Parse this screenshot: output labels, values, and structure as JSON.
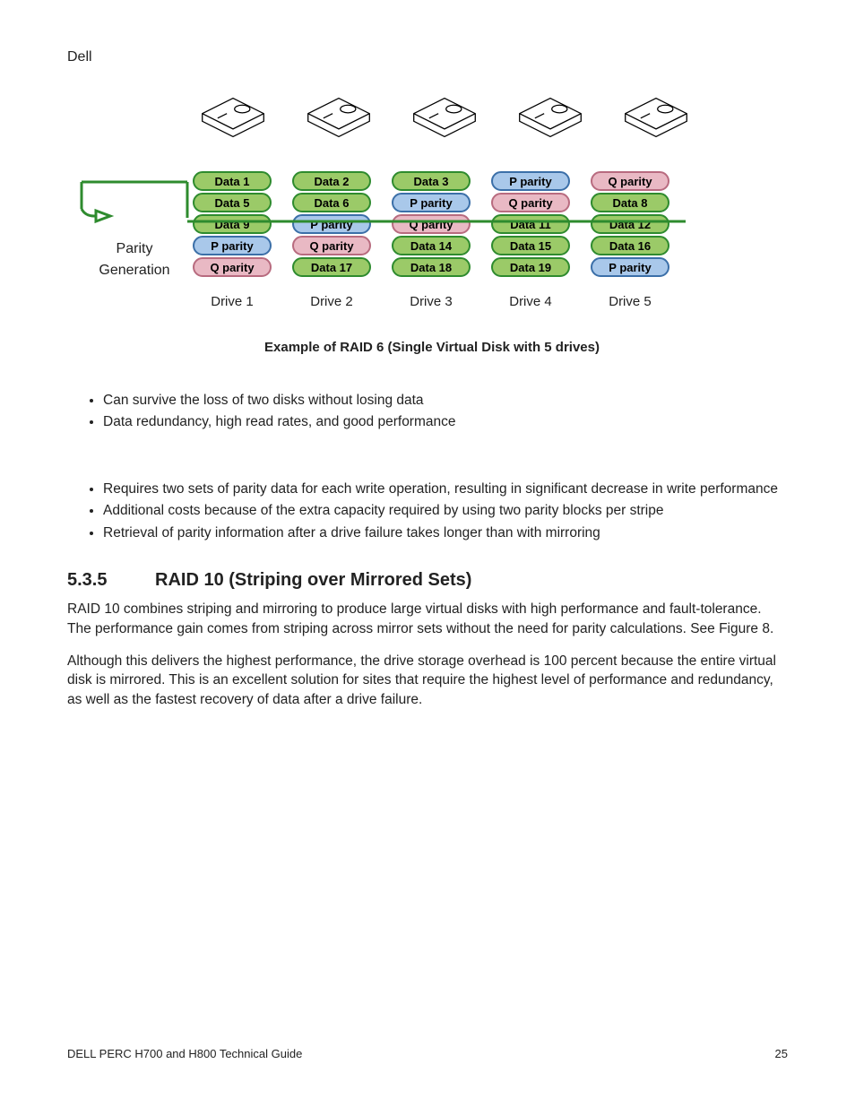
{
  "brand": "Dell",
  "diagram": {
    "parityLabel1": "Parity",
    "parityLabel2": "Generation",
    "drives": [
      {
        "label": "Drive 1",
        "cells": [
          {
            "t": "Data 1",
            "k": "data"
          },
          {
            "t": "Data 5",
            "k": "data"
          },
          {
            "t": "Data 9",
            "k": "data"
          },
          {
            "t": "P parity",
            "k": "p"
          },
          {
            "t": "Q parity",
            "k": "q"
          }
        ]
      },
      {
        "label": "Drive 2",
        "cells": [
          {
            "t": "Data 2",
            "k": "data"
          },
          {
            "t": "Data 6",
            "k": "data"
          },
          {
            "t": "P parity",
            "k": "p"
          },
          {
            "t": "Q parity",
            "k": "q"
          },
          {
            "t": "Data 17",
            "k": "data"
          }
        ]
      },
      {
        "label": "Drive 3",
        "cells": [
          {
            "t": "Data 3",
            "k": "data"
          },
          {
            "t": "P parity",
            "k": "p"
          },
          {
            "t": "Q parity",
            "k": "q"
          },
          {
            "t": "Data 14",
            "k": "data"
          },
          {
            "t": "Data 18",
            "k": "data"
          }
        ]
      },
      {
        "label": "Drive 4",
        "cells": [
          {
            "t": "P parity",
            "k": "p"
          },
          {
            "t": "Q parity",
            "k": "q"
          },
          {
            "t": "Data 11",
            "k": "data"
          },
          {
            "t": "Data 15",
            "k": "data"
          },
          {
            "t": "Data 19",
            "k": "data"
          }
        ]
      },
      {
        "label": "Drive 5",
        "cells": [
          {
            "t": "Q parity",
            "k": "q"
          },
          {
            "t": "Data 8",
            "k": "data"
          },
          {
            "t": "Data 12",
            "k": "data"
          },
          {
            "t": "Data 16",
            "k": "data"
          },
          {
            "t": "P parity",
            "k": "p"
          }
        ]
      }
    ],
    "caption": "Example of RAID 6 (Single Virtual Disk with 5 drives)"
  },
  "pros": [
    "Can survive the loss of two disks without losing data",
    "Data redundancy, high read rates, and good performance"
  ],
  "cons": [
    "Requires two sets of parity data for each write operation, resulting in significant decrease in write performance",
    "Additional costs because of the extra capacity required by using two parity blocks per stripe",
    "Retrieval of parity information after a drive failure takes longer than with mirroring"
  ],
  "section": {
    "num": "5.3.5",
    "title": "RAID 10 (Striping over Mirrored Sets)",
    "p1": "RAID 10 combines striping and mirroring to produce large virtual disks with high performance and fault-tolerance. The performance gain comes from striping across mirror sets without the need for parity calculations. See Figure 8.",
    "p2": "Although this delivers the highest performance, the drive storage overhead is 100 percent because the entire virtual disk is mirrored. This is an excellent solution for sites that require the highest level of performance and redundancy, as well as the fastest recovery of data after a drive failure."
  },
  "footer": {
    "left": "DELL PERC H700 and H800 Technical Guide",
    "right": "25"
  }
}
